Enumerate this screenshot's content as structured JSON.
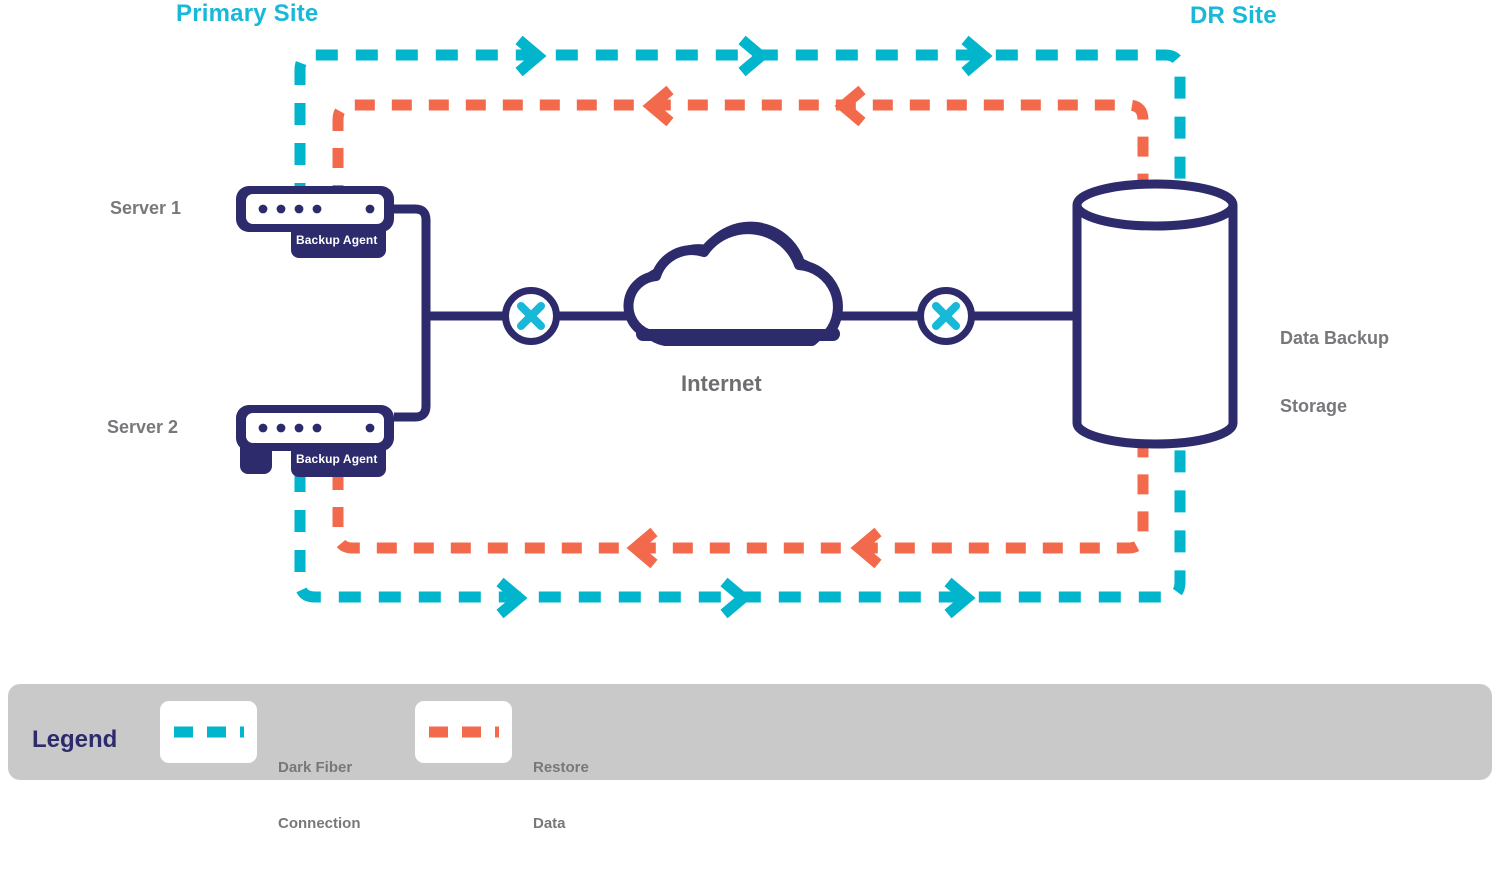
{
  "diagram": {
    "title_primary": "Primary Site",
    "title_dr": "DR Site",
    "colors": {
      "cyan": "#00b5cc",
      "orange": "#f2694b",
      "navy": "#2d2b6b",
      "gray_text": "#77787b",
      "legend_bg": "#c9c9c9",
      "white": "#ffffff"
    },
    "nodes": {
      "server1_label": "Server 1",
      "server2_label": "Server 2",
      "server1_agent": "Backup Agent",
      "server2_agent": "Backup Agent",
      "internet_label": "Internet",
      "storage_label": "Data Backup\nStorage",
      "storage_label_line1": "Data Backup",
      "storage_label_line2": "Storage"
    },
    "icons": {
      "router_left": "router-x-icon",
      "router_right": "router-x-icon",
      "cloud": "cloud-icon",
      "storage": "database-cylinder-icon",
      "server": "server-rack-icon"
    },
    "flows": [
      {
        "name": "dark-fiber-top",
        "color": "#00b5cc",
        "direction": "right",
        "arrows": 3
      },
      {
        "name": "restore-top",
        "color": "#f2694b",
        "direction": "left",
        "arrows": 2
      },
      {
        "name": "dark-fiber-bottom",
        "color": "#00b5cc",
        "direction": "right",
        "arrows": 3
      },
      {
        "name": "restore-bottom",
        "color": "#f2694b",
        "direction": "left",
        "arrows": 2
      }
    ]
  },
  "legend": {
    "title": "Legend",
    "items": [
      {
        "swatch_color": "#00b5cc",
        "label_line1": "Dark Fiber",
        "label_line2": "Connection"
      },
      {
        "swatch_color": "#f2694b",
        "label_line1": "Restore",
        "label_line2": "Data"
      }
    ]
  }
}
